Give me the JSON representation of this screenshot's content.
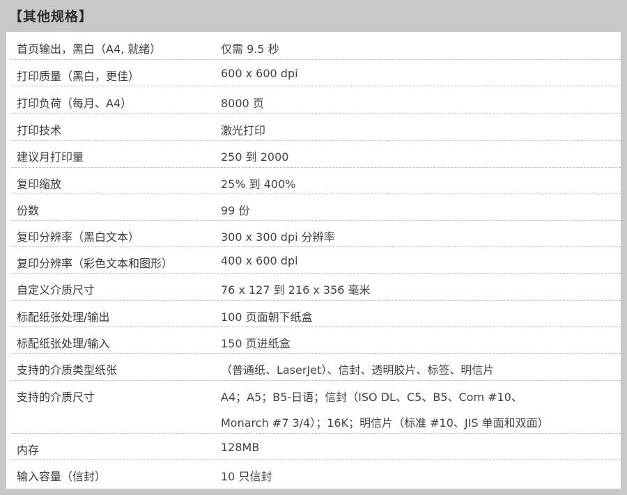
{
  "header": {
    "title": "【其他规格】"
  },
  "specs": [
    {
      "label": "首页输出，黑白（A4, 就绪）",
      "value": "仅需 9.5 秒"
    },
    {
      "label": "打印质量（黑白，更佳）",
      "value": "600 x 600 dpi"
    },
    {
      "label": "打印负荷（每月、A4）",
      "value": "8000 页"
    },
    {
      "label": "打印技术",
      "value": "激光打印"
    },
    {
      "label": "建议月打印量",
      "value": "250 到 2000"
    },
    {
      "label": "复印缩放",
      "value": "25% 到 400%"
    },
    {
      "label": "份数",
      "value": "99 份"
    },
    {
      "label": "复印分辨率（黑白文本）",
      "value": "300 x 300 dpi 分辨率"
    },
    {
      "label": "复印分辨率（彩色文本和图形）",
      "value": "400 x 600 dpi"
    },
    {
      "label": "自定义介质尺寸",
      "value": "76 x 127 到 216 x 356 毫米"
    },
    {
      "label": "标配纸张处理/输出",
      "value": "100 页面朝下纸盒"
    },
    {
      "label": "标配纸张处理/输入",
      "value": "150 页进纸盒"
    },
    {
      "label": "支持的介质类型纸张",
      "value": "（普通纸、LaserJet）、信封、透明胶片、标签、明信片"
    },
    {
      "label": "支持的介质尺寸",
      "value": "A4；A5；B5-日语；信封（ISO DL、C5、B5、Com #10、",
      "value2": "Monarch #7 3/4）；16K；明信片（标准 #10、JIS 单面和双面）"
    },
    {
      "label": "内存",
      "value": "128MB"
    },
    {
      "label": "输入容量（信封）",
      "value": "10 只信封"
    }
  ]
}
